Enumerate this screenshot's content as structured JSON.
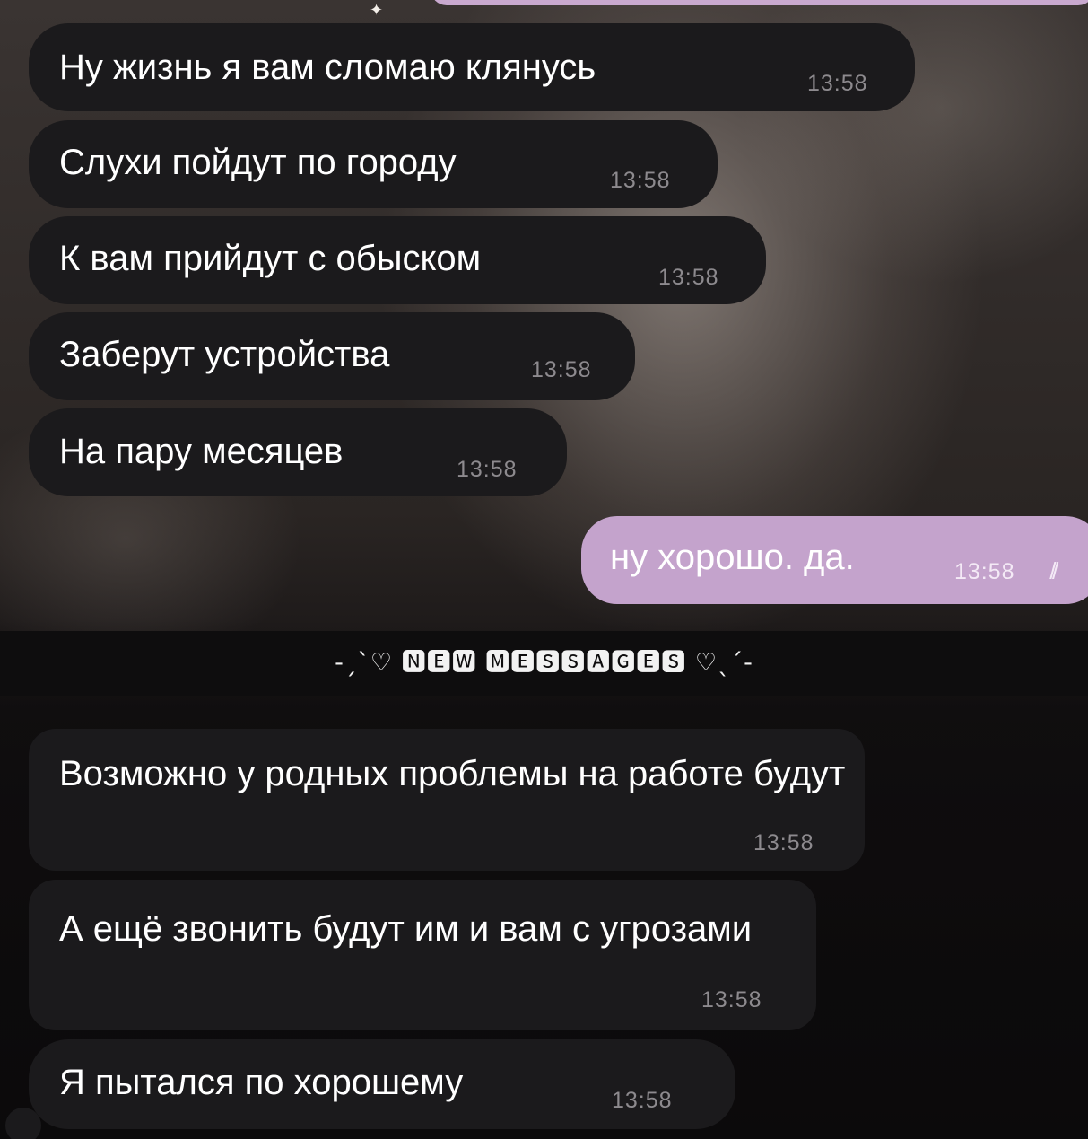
{
  "chat": {
    "messages": [
      {
        "direction": "incoming",
        "text": "Ну жизнь я вам сломаю клянусь",
        "time": "13:58"
      },
      {
        "direction": "incoming",
        "text": "Слухи пойдут по городу",
        "time": "13:58"
      },
      {
        "direction": "incoming",
        "text": "К вам прийдут с обыском",
        "time": "13:58"
      },
      {
        "direction": "incoming",
        "text": "Заберут устройства",
        "time": "13:58"
      },
      {
        "direction": "incoming",
        "text": "На пару месяцев",
        "time": "13:58"
      },
      {
        "direction": "outgoing",
        "text": "ну хорошо. да.",
        "time": "13:58",
        "status": "read"
      },
      {
        "direction": "incoming",
        "text": "Возможно у родных проблемы на работе будут",
        "time": "13:58"
      },
      {
        "direction": "incoming",
        "text": "А ещё звонить будут им и вам с угрозами",
        "time": "13:58"
      },
      {
        "direction": "incoming",
        "text": "Я пытался по хорошему",
        "time": "13:58"
      }
    ],
    "divider": {
      "label": "-ˏˋ♡ 🅽🅴🆆 🅼🅴🆂🆂🅰🅶🅴🆂 ♡ˎˊ-"
    },
    "read_receipt_icon": "double-check-icon",
    "colors": {
      "incoming_bubble": "#1b1a1c",
      "outgoing_bubble": "#c4a3cc",
      "timestamp": "#8d8a8e"
    }
  }
}
